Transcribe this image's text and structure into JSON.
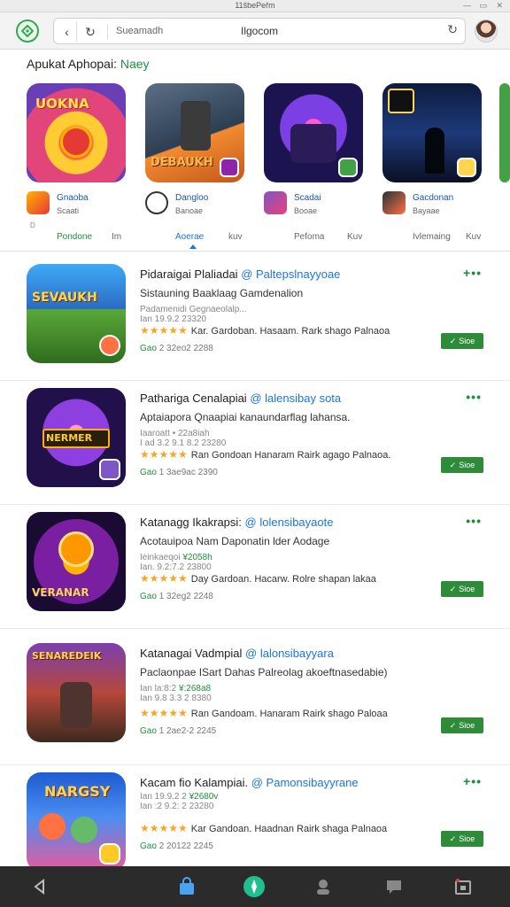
{
  "window": {
    "title": "11ŝbePeřm"
  },
  "browser": {
    "url_left": "Sueamadh",
    "url_host": "Ilgocom"
  },
  "section": {
    "title_prefix": "Apukat Aphopai:",
    "title_accent": "Naey"
  },
  "featured": [
    {
      "art_text": "UOKNA",
      "name": "Gnaoba",
      "sub": "Scaati",
      "dot": "D"
    },
    {
      "art_text": "DEBAUKH",
      "name": "Dangloo",
      "sub": "Banoae",
      "dot": ""
    },
    {
      "art_text": "",
      "name": "Scadai",
      "sub": "Booae",
      "dot": ""
    },
    {
      "art_text": "",
      "name": "Gacdonan",
      "sub": "Bayaae",
      "dot": ""
    }
  ],
  "tabs": [
    {
      "label": "Pondone"
    },
    {
      "label": "Im"
    },
    {
      "label": "Aoerae"
    },
    {
      "label": "kuv"
    },
    {
      "label": "Pefoma"
    },
    {
      "label": "Kuv"
    },
    {
      "label": "Ivlemaing"
    },
    {
      "label": "Kuv"
    }
  ],
  "list": [
    {
      "title": "Pidaraigai Plaliadai",
      "dev": "@ Paltepslnayyoae",
      "desc": "Sistauning Baaklaag Gamdenalion",
      "meta1a": "Padamenidi Gegnaeolalp...",
      "meta1b": "",
      "meta1c": "Ian 19.9.2 23320",
      "stars": "★★★★★",
      "rating_text": "Kar. Gardoban. Hasaam. Rark shago Palnaoa",
      "meta2a": "Gao",
      "meta2b": "2 32eo2 2288",
      "install": "Sioe",
      "art_text": "SEVAUKH"
    },
    {
      "title": "Pathariga Cenalapiai",
      "dev": "@ lalensibay sota",
      "desc": "Aptaiapora Qnaapiai kanaundarflag lahansa.",
      "meta1a": "Iaaroatt • 22a8iah",
      "meta1b": "",
      "meta1c": "I ad 3.2 9.1 8.2 23280",
      "stars": "★★★★★",
      "rating_text": "Ran Gondoan Hanaram Rairk agago Palnaoa.",
      "meta2a": "Gao",
      "meta2b": "1 3ae9ac 2390",
      "install": "Sioe",
      "art_text": "NERMER"
    },
    {
      "title": "Katanagg Ikakrapsi:",
      "dev": "@ lolensibayaote",
      "desc": "Acotauipoa Nam Daponatin lder Aodage",
      "meta1a": "Ieinkaeqoi",
      "meta1b": "¥2058h",
      "meta1c": "Ian. 9.2:7.2 23800",
      "stars": "★★★★★",
      "rating_text": "Day Gardoan. Hacarw. Rolre shapan lakaa",
      "meta2a": "Gao",
      "meta2b": "1 32eg2 2248",
      "install": "Sioe",
      "art_text": "VERANAR"
    },
    {
      "title": "Katanagai Vadmpial",
      "dev": "@ lalonsibayyara",
      "desc": "Paclaonpae ISart Dahas Palreolag akoeftnasedabie)",
      "meta1a": "Ian la:8:2",
      "meta1b": "¥:268a8",
      "meta1c": "Ian 9.8 3.3 2 8380",
      "stars": "★★★★★",
      "rating_text": "Ran Gandoam. Hanaram Rairk shago Paloaa",
      "meta2a": "Gao",
      "meta2b": "1 2ae2-2 2245",
      "install": "Sioe",
      "art_text": "SENAREDEIK"
    },
    {
      "title": "Kacam fio Kalampiai.",
      "dev": "@ Pamonsibayyrane",
      "desc": "",
      "meta1a": "Ian 19.9.2 2",
      "meta1b": "¥2680v",
      "meta1c": "Ian :2 9.2: 2 23280",
      "stars": "★★★★★",
      "rating_text": "Kar Gandoan. Haadnan Rairk shaga Palnaoa",
      "meta2a": "Gao",
      "meta2b": "2 20122 2245",
      "install": "Sioe",
      "art_text": "NARGSY"
    }
  ],
  "colors": {
    "accent_green": "#1e8e3e",
    "install_green": "#2e8b3a",
    "link_blue": "#1a73e8",
    "star": "#f5a623",
    "bottom_bar": "#2b2b2b"
  },
  "bottom_nav": [
    {
      "icon": "back-triangle-icon"
    },
    {
      "icon": "store-bag-icon"
    },
    {
      "icon": "compass-icon"
    },
    {
      "icon": "person-icon"
    },
    {
      "icon": "chat-bubble-icon"
    },
    {
      "icon": "calendar-icon"
    }
  ]
}
